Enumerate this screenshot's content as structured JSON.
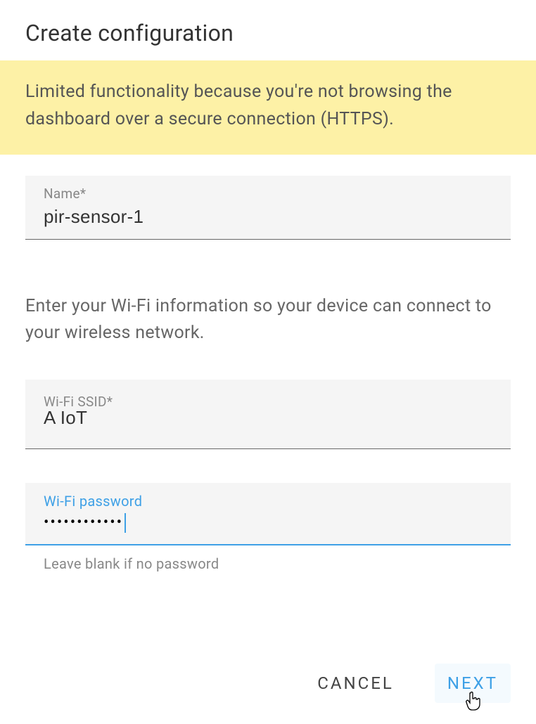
{
  "dialog": {
    "title": "Create configuration",
    "warning": "Limited functionality because you're not browsing the dashboard over a secure connection (HTTPS)."
  },
  "fields": {
    "name": {
      "label": "Name*",
      "value": "pir-sensor-1"
    },
    "wifi_intro": "Enter your Wi-Fi information so your device can connect to your wireless network.",
    "ssid": {
      "label": "Wi-Fi SSID*",
      "value": "A IoT"
    },
    "password": {
      "label": "Wi-Fi password",
      "value": "••••••••••••",
      "helper": "Leave blank if no password"
    }
  },
  "actions": {
    "cancel": "CANCEL",
    "next": "NEXT"
  },
  "colors": {
    "accent": "#3ea0e6",
    "warning_bg": "#fdf1a6"
  }
}
